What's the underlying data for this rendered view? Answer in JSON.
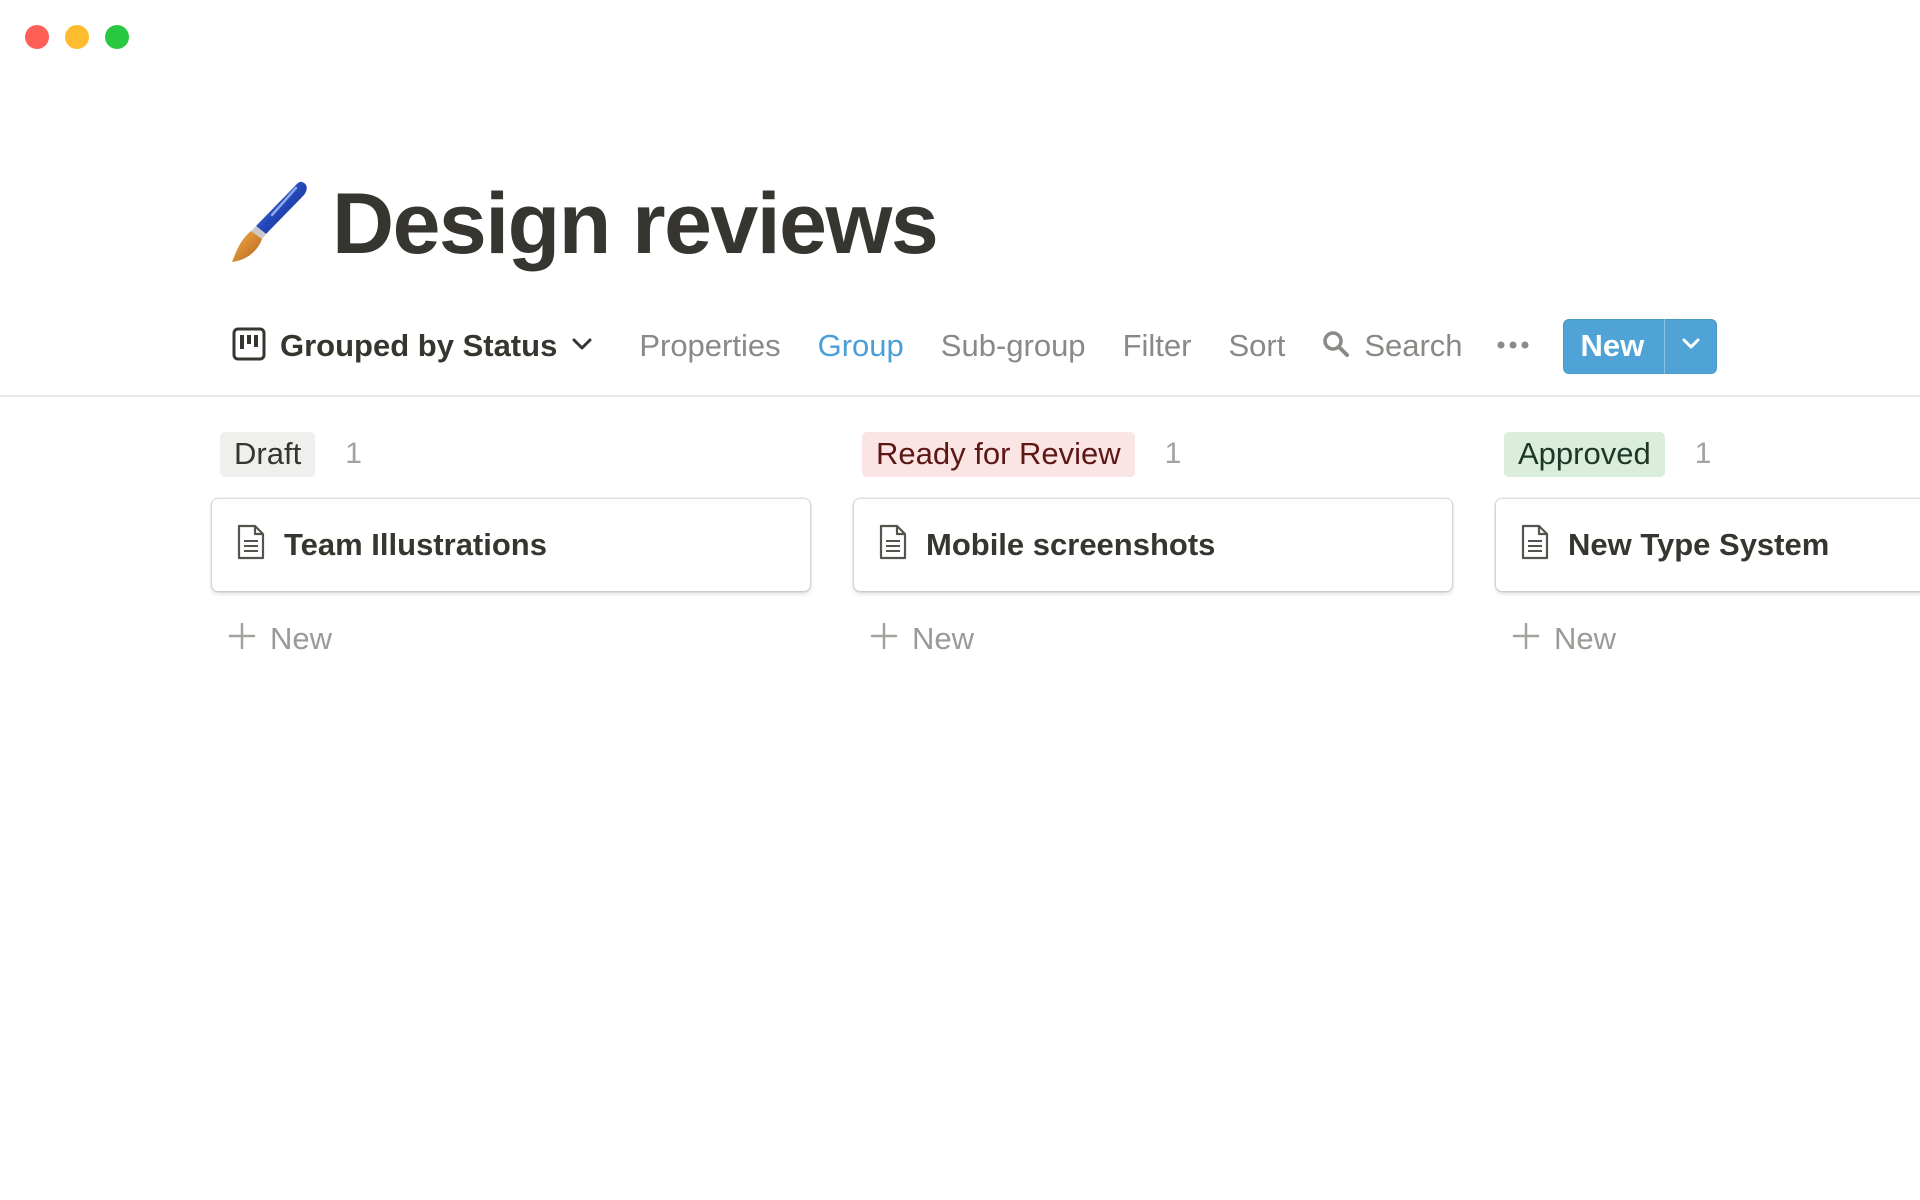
{
  "window": {
    "controls": [
      "close",
      "minimize",
      "zoom"
    ]
  },
  "page": {
    "icon": "paintbrush-icon",
    "title": "Design reviews"
  },
  "toolbar": {
    "view_icon": "board-view-icon",
    "view_label": "Grouped by Status",
    "links": {
      "properties": "Properties",
      "group": "Group",
      "subgroup": "Sub-group",
      "filter": "Filter",
      "sort": "Sort"
    },
    "search_label": "Search",
    "new_label": "New",
    "accent_color": "#4fa3d6"
  },
  "board": {
    "columns": [
      {
        "status": "Draft",
        "count": "1",
        "tag_bg": "#efefee",
        "tag_fg": "#37352f",
        "cards": [
          {
            "title": "Team Illustrations"
          }
        ],
        "add_label": "New"
      },
      {
        "status": "Ready for Review",
        "count": "1",
        "tag_bg": "#fbe4e4",
        "tag_fg": "#5d1715",
        "cards": [
          {
            "title": "Mobile screenshots"
          }
        ],
        "add_label": "New"
      },
      {
        "status": "Approved",
        "count": "1",
        "tag_bg": "#dbeddb",
        "tag_fg": "#1c3829",
        "cards": [
          {
            "title": "New Type System"
          }
        ],
        "add_label": "New"
      }
    ]
  }
}
